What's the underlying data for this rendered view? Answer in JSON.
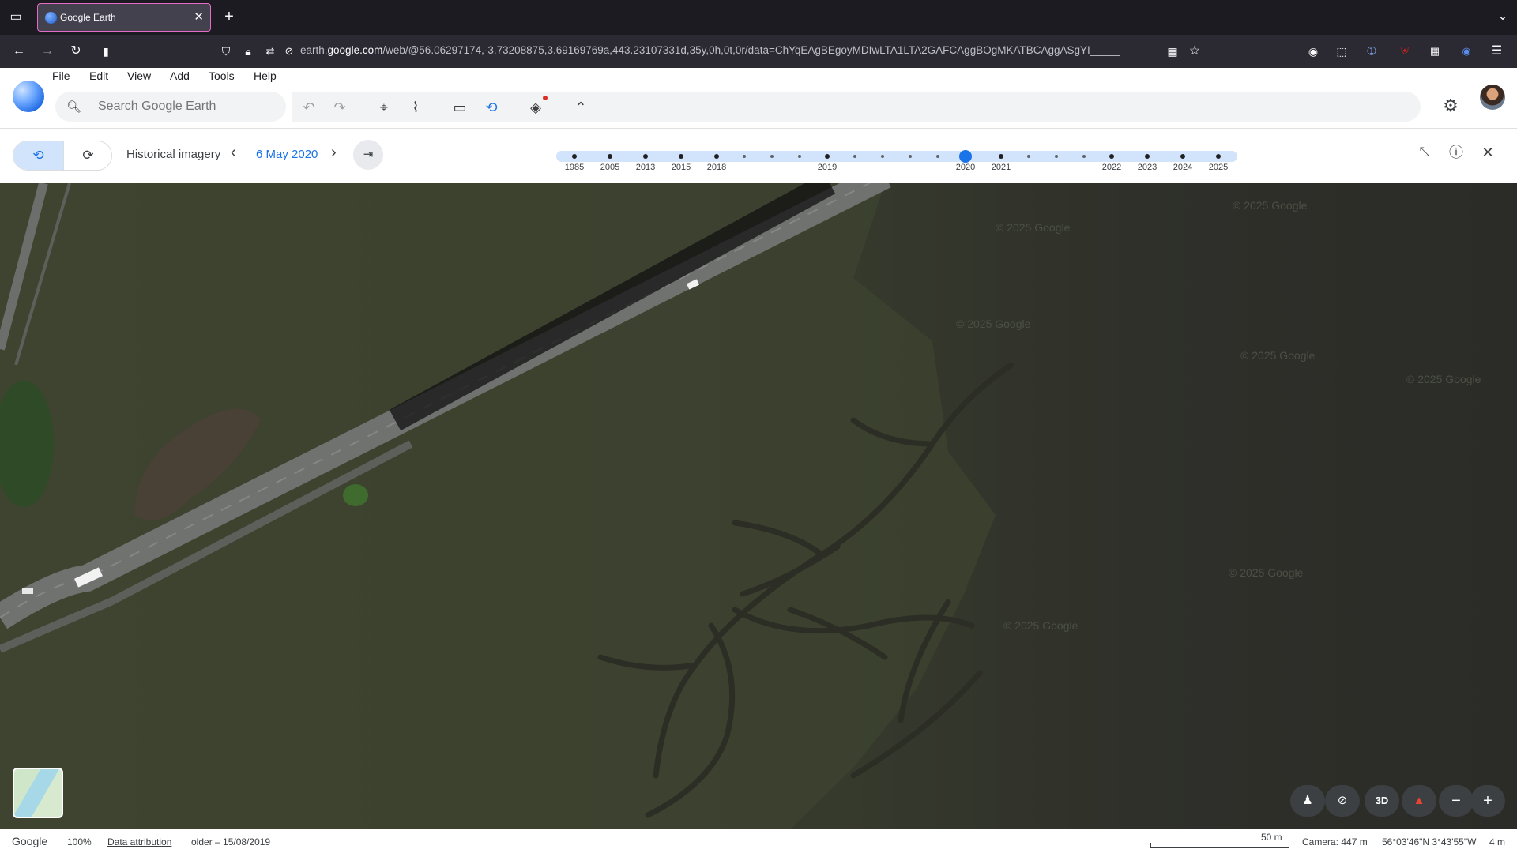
{
  "browser": {
    "tab_title": "Google Earth",
    "url_prefix": "earth.",
    "url_domain": "google.com",
    "url_rest": "/web/@56.06297174,-3.73208875,3.69169769a,443.23107331d,35y,0h,0t,0r/data=ChYqEAgBEgoyMDIwLTA1LTA2GAFCAggBOgMKATBCAggASgYI_____"
  },
  "menu": [
    "File",
    "Edit",
    "View",
    "Add",
    "Tools",
    "Help"
  ],
  "search": {
    "placeholder": "Search Google Earth"
  },
  "historical": {
    "label": "Historical imagery",
    "date": "6 May 2020",
    "years": [
      "1985",
      "2005",
      "2013",
      "2015",
      "2018",
      "2019",
      "2020",
      "2021",
      "2022",
      "2023",
      "2024",
      "2025"
    ],
    "selected_year": "2020"
  },
  "map": {
    "watermark": "© 2025 Google",
    "controls": {
      "view3d": "3D"
    }
  },
  "status": {
    "brand": "Google",
    "zoom": "100%",
    "attribution": "Data attribution",
    "imagery_date": "older – 15/08/2019",
    "scale": "50 m",
    "camera": "Camera: 447 m",
    "coords": "56°03'46\"N 3°43'55\"W",
    "elevation": "4 m"
  }
}
